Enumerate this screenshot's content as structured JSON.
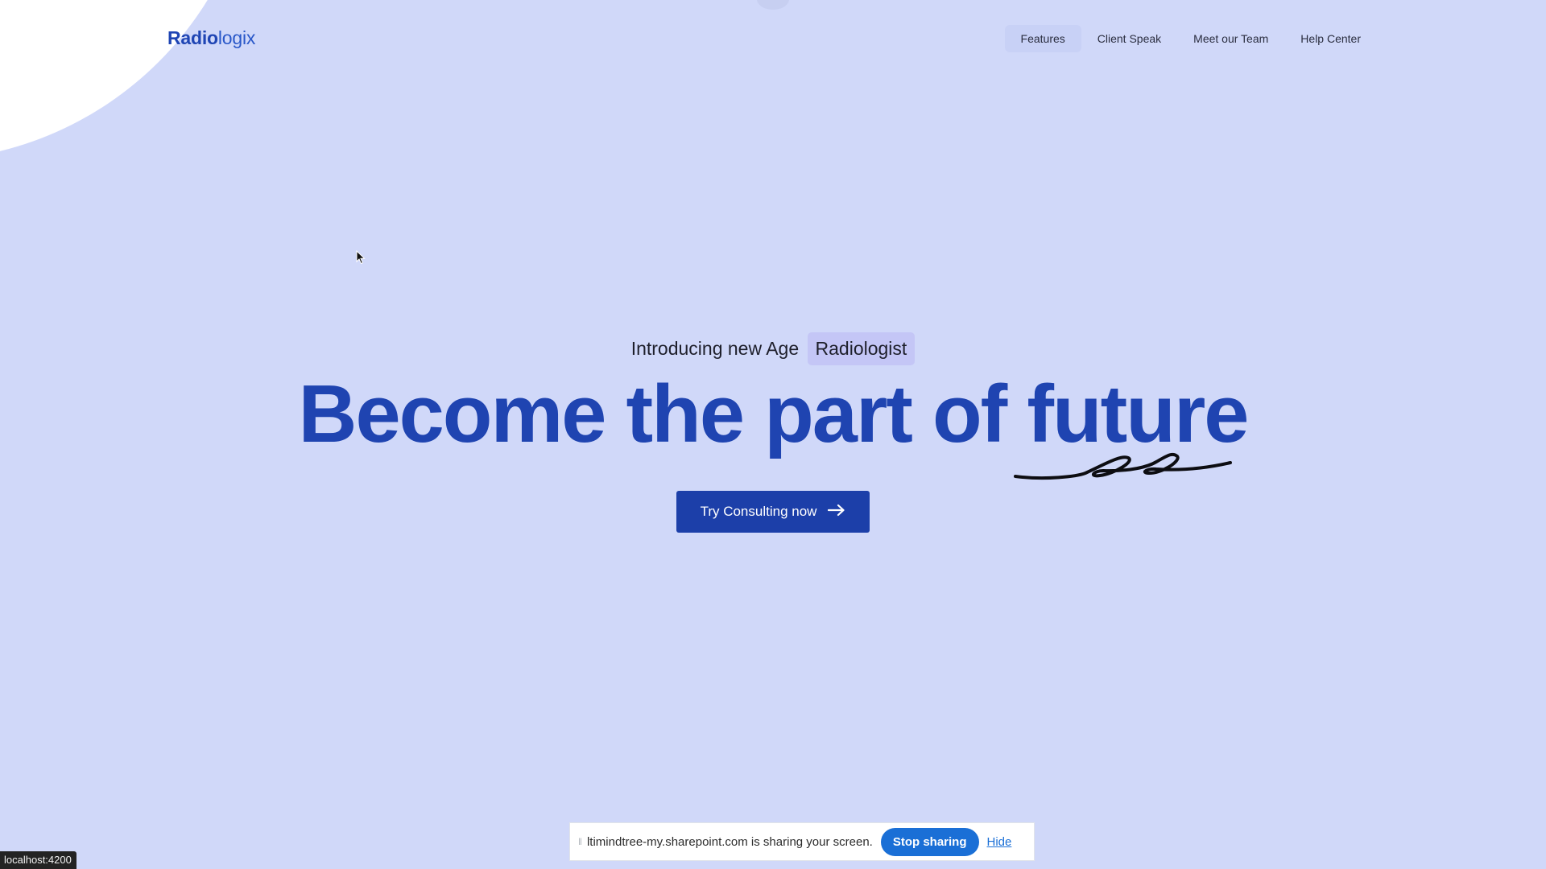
{
  "logo": {
    "bold_part": "Radio",
    "light_part": "logix"
  },
  "nav": {
    "items": [
      {
        "label": "Features"
      },
      {
        "label": "Client Speak"
      },
      {
        "label": "Meet our Team"
      },
      {
        "label": "Help Center"
      }
    ]
  },
  "hero": {
    "tag_prefix": "Introducing new Age",
    "tag_highlight": "Radiologist",
    "headline": "Become the part of future",
    "cta_label": "Try Consulting now",
    "cta_icon": "arrow-right-icon"
  },
  "share_bar": {
    "message": "ltimindtree-my.sharepoint.com is sharing your screen.",
    "stop_label": "Stop sharing",
    "hide_label": "Hide",
    "grip_icon": "drag-handle-icon"
  },
  "status_bar": {
    "url": "localhost:4200"
  },
  "colors": {
    "background": "#d0d8f9",
    "brand": "#1f44b1",
    "cta": "#1c3fa9",
    "share_accent": "#1a6fd6"
  }
}
